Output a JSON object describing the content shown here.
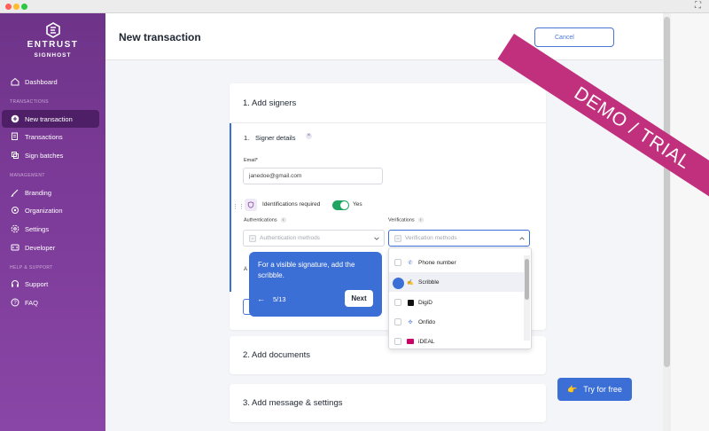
{
  "sidebar": {
    "brand": "ENTRUST",
    "sub_brand": "SIGNHOST",
    "sections": {
      "transactions": "TRANSACTIONS",
      "management": "MANAGEMENT",
      "help": "HELP & SUPPORT"
    },
    "items": [
      {
        "label": "Dashboard",
        "icon": "home-icon"
      },
      {
        "label": "New transaction",
        "icon": "plus-circle-icon",
        "active": true
      },
      {
        "label": "Transactions",
        "icon": "documents-icon"
      },
      {
        "label": "Sign batches",
        "icon": "layers-icon"
      },
      {
        "label": "Branding",
        "icon": "brush-icon"
      },
      {
        "label": "Organization",
        "icon": "gear-icon"
      },
      {
        "label": "Settings",
        "icon": "settings-icon"
      },
      {
        "label": "Developer",
        "icon": "code-icon"
      },
      {
        "label": "Support",
        "icon": "headset-icon"
      },
      {
        "label": "FAQ",
        "icon": "question-icon"
      }
    ]
  },
  "header": {
    "title": "New transaction",
    "cancel_label": "Cancel"
  },
  "ribbon": "DEMO / TRIAL",
  "step1": {
    "title": "1. Add signers",
    "signer_index": "1.",
    "signer_title": "Signer details",
    "email_label": "Email*",
    "email_value": "janedoe@gmail.com",
    "identification_label": "Identifications required",
    "identification_value": "Yes",
    "authentications_label": "Authentications",
    "authentications_placeholder": "Authentication methods",
    "verifications_label": "Verifications",
    "verifications_placeholder": "Verification methods",
    "hidden_label_fragment": "A"
  },
  "verification_options": [
    {
      "label": "Phone number",
      "icon": "phone-icon"
    },
    {
      "label": "Scribble",
      "icon": "signature-icon"
    },
    {
      "label": "DigiD",
      "icon": "digid-icon"
    },
    {
      "label": "Onfido",
      "icon": "onfido-icon"
    },
    {
      "label": "iDEAL",
      "icon": "ideal-icon"
    }
  ],
  "tour": {
    "text": "For a visible signature, add the scribble.",
    "step": "5/13",
    "next_label": "Next"
  },
  "step2": {
    "title": "2. Add documents"
  },
  "step3": {
    "title": "3. Add message & settings"
  },
  "try_button": {
    "label": "Try for free",
    "icon": "pointing-hand-icon"
  },
  "colors": {
    "sidebar": "#7b3a97",
    "accent": "#3c6fd6",
    "toggle_on": "#1ea561",
    "ribbon": "#c0307d"
  }
}
